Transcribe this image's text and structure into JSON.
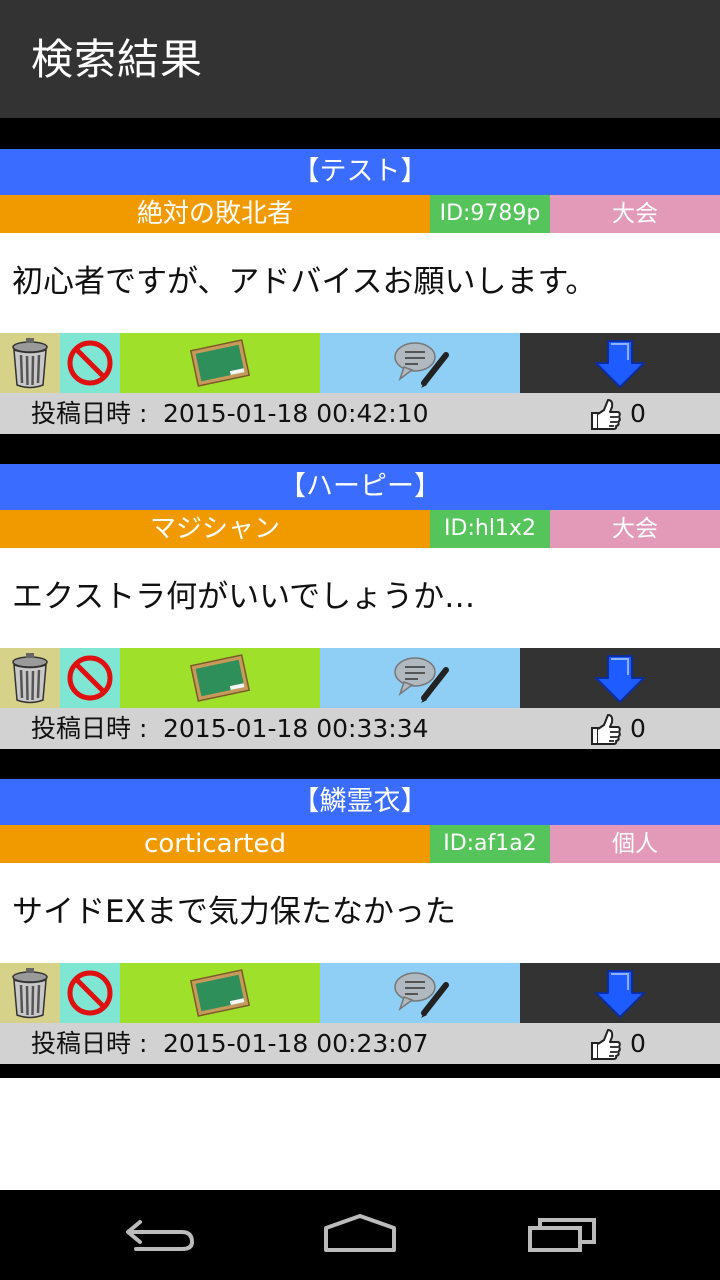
{
  "header": {
    "title": "検索結果"
  },
  "colors": {
    "topic_bar": "#3a6cff",
    "author_bar": "#f09a00",
    "id_bar": "#55c45a",
    "type_bar": "#e39ab8",
    "footer_bar": "#d2d2d2"
  },
  "posts": [
    {
      "topic": "【テスト】",
      "author": "絶対の敗北者",
      "user_id": "ID:9789p",
      "type": "大会",
      "body": "初心者ですが、アドバイスお願いします。",
      "date_label": "投稿日時 :",
      "date": "2015-01-18 00:42:10",
      "likes": "0"
    },
    {
      "topic": "【ハーピー】",
      "author": "マジシャン",
      "user_id": "ID:hl1x2",
      "type": "大会",
      "body": "エクストラ何がいいでしょうか…",
      "date_label": "投稿日時 :",
      "date": "2015-01-18 00:33:34",
      "likes": "0"
    },
    {
      "topic": "【鱗霊衣】",
      "author": "corticarted",
      "user_id": "ID:af1a2",
      "type": "個人",
      "body": "サイドEXまで気力保たなかった",
      "date_label": "投稿日時 :",
      "date": "2015-01-18 00:23:07",
      "likes": "0"
    }
  ],
  "actions": {
    "icons": [
      "trash-icon",
      "no-entry-icon",
      "chalkboard-icon",
      "comment-pencil-icon",
      "down-arrow-icon"
    ]
  },
  "navbar": {
    "icons": [
      "back-icon",
      "home-icon",
      "recent-apps-icon"
    ]
  }
}
